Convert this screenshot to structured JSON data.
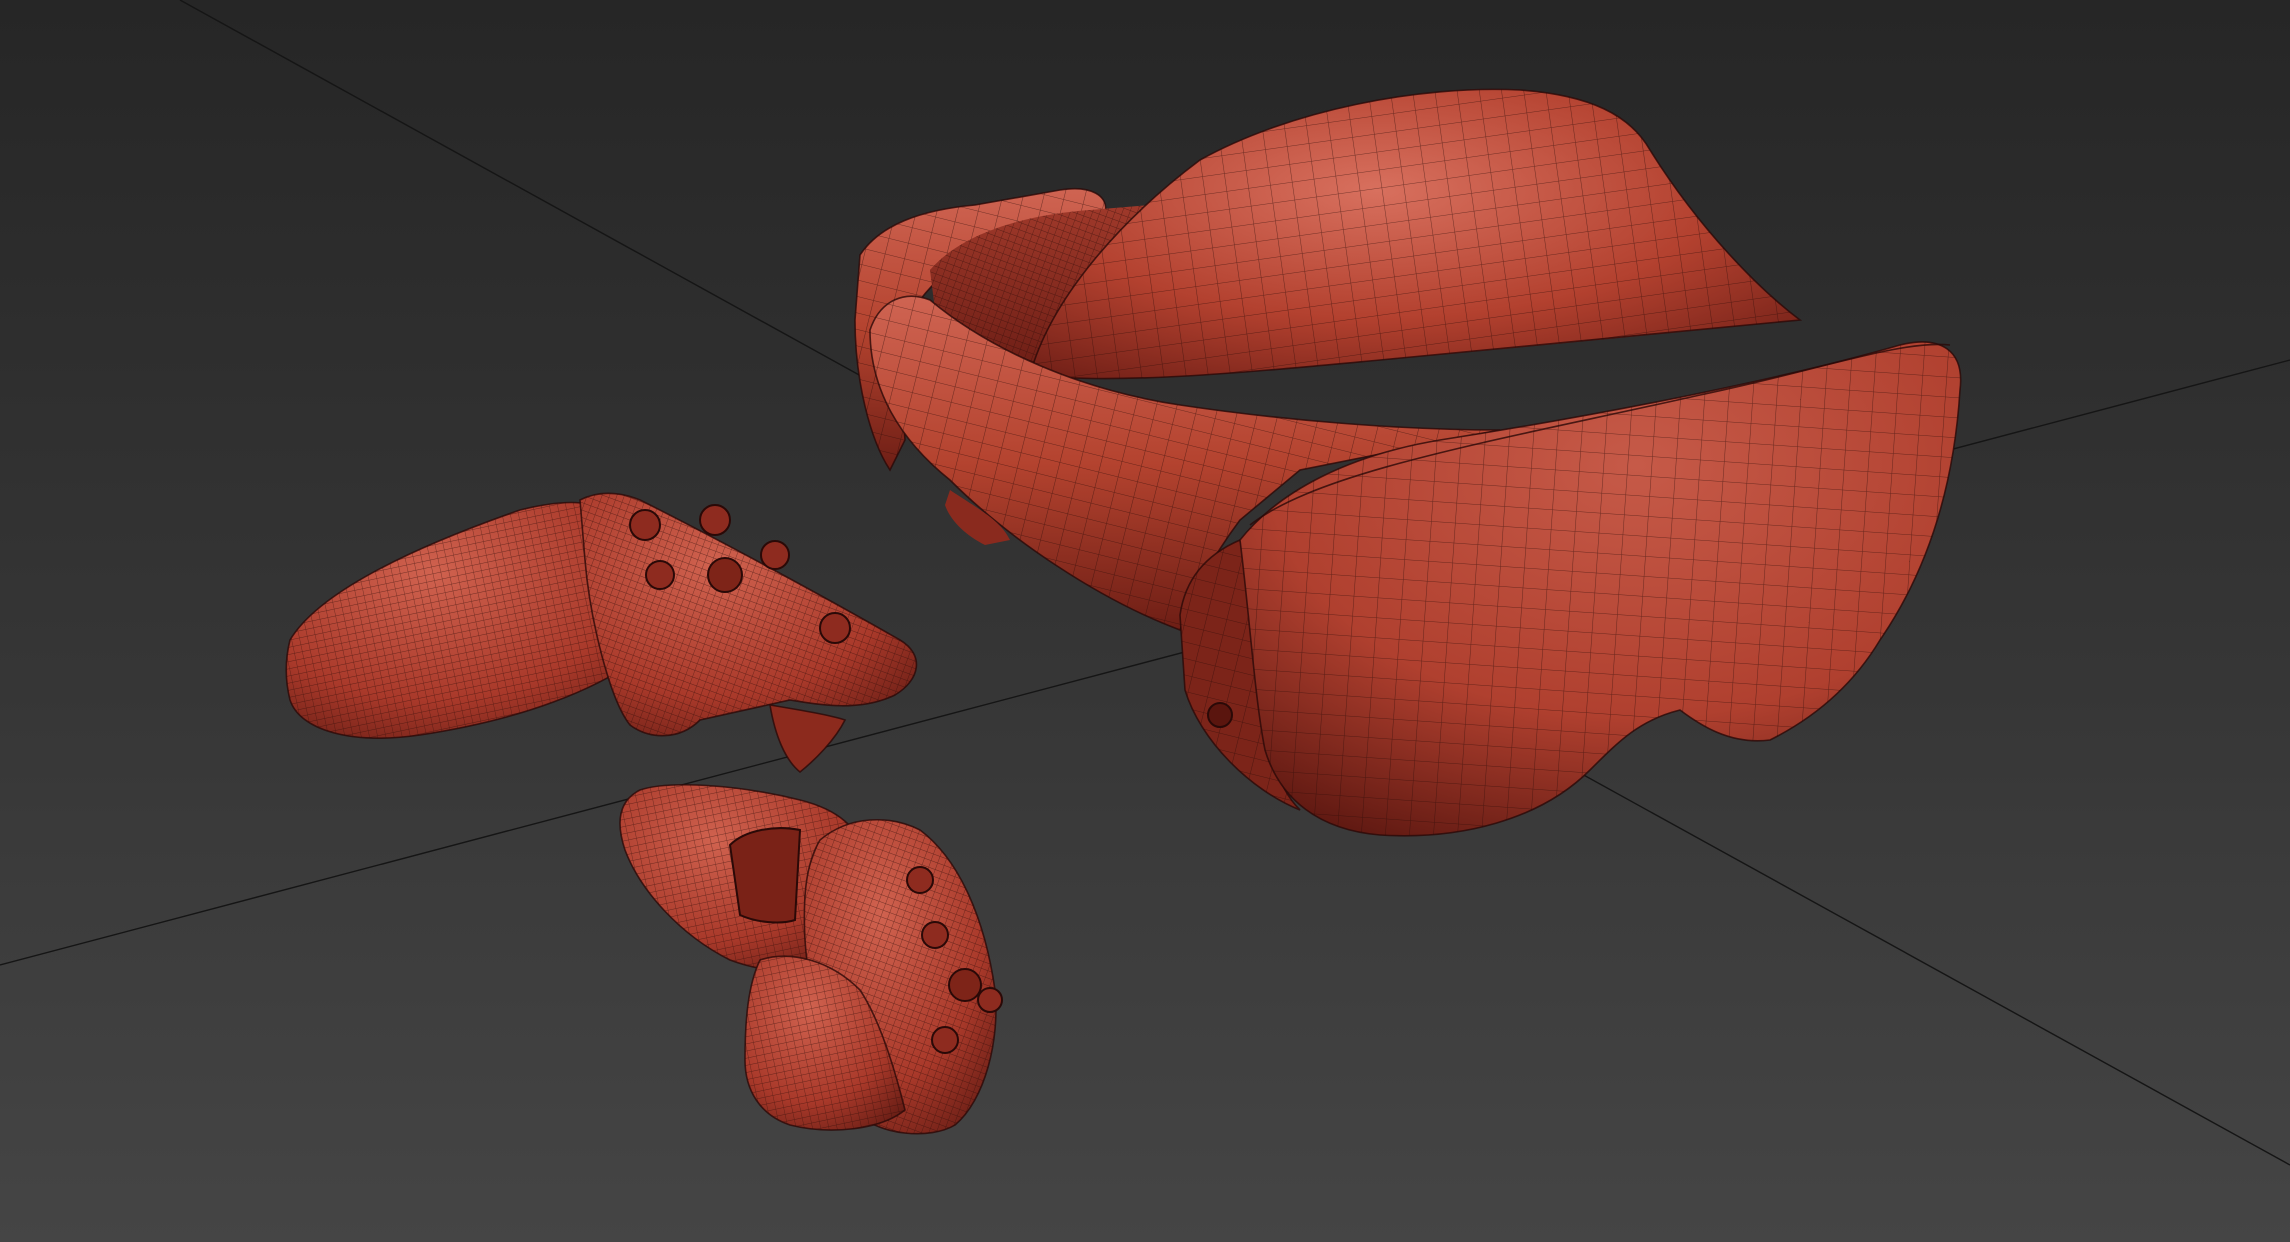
{
  "viewport": {
    "background_color": "#3a3a3a",
    "floor_grid_color": "#151515",
    "display_mode": "wireframe-on-shaded",
    "material_color": "#b74434",
    "material_highlight": "#d96a56",
    "material_shadow": "#6a1c14",
    "wire_color": "#2c0b08"
  },
  "scene": {
    "objects": [
      {
        "name": "vr-headset",
        "icon": "vr-headset-icon"
      },
      {
        "name": "left-controller",
        "icon": "game-controller-icon"
      },
      {
        "name": "right-controller",
        "icon": "game-controller-icon"
      }
    ]
  }
}
